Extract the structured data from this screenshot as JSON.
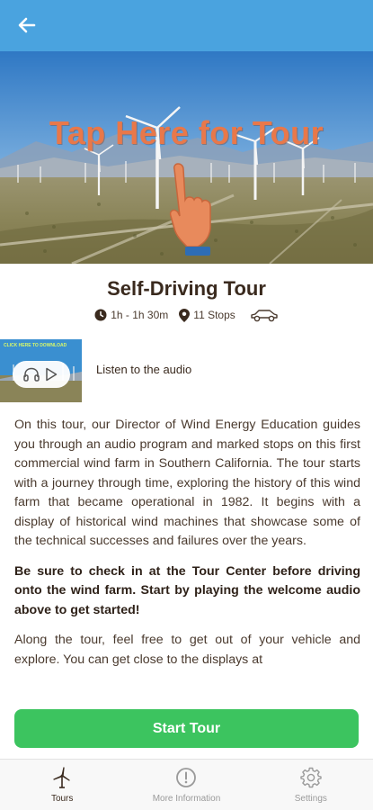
{
  "header": {
    "back_icon": "arrow-left-icon"
  },
  "hero": {
    "overlay_text": "Tap Here for Tour",
    "pointer_icon": "hand-pointer-icon"
  },
  "tour": {
    "title": "Self-Driving Tour",
    "duration": "1h - 1h 30m",
    "stops": "11 Stops",
    "duration_icon": "clock-icon",
    "stops_icon": "map-pin-icon",
    "vehicle_icon": "car-icon"
  },
  "audio": {
    "thumb_caption": "CLICK HERE TO DOWNLOAD",
    "label": "Listen to the audio",
    "headphones_icon": "headphones-icon",
    "play_icon": "play-icon"
  },
  "description": {
    "p1": "On this tour, our Director of Wind Energy Education guides you through an audio program and marked stops on this first commercial wind farm in Southern California. The tour starts with a journey through time, exploring the history of this wind farm that became operational in 1982. It begins with a display of historical wind machines that showcase some of the technical successes and failures over the years.",
    "p2": "Be sure to check in at the Tour Center before driving onto the wind farm. Start by playing the welcome audio above to get started!",
    "p3": "Along the tour, feel free to get out of your vehicle and explore. You can get close to the displays at"
  },
  "actions": {
    "start_label": "Start Tour"
  },
  "nav": {
    "items": [
      {
        "label": "Tours",
        "icon": "wind-turbine-icon",
        "active": true
      },
      {
        "label": "More Information",
        "icon": "info-circle-icon",
        "active": false
      },
      {
        "label": "Settings",
        "icon": "gear-icon",
        "active": false
      }
    ]
  },
  "colors": {
    "header": "#4aa3df",
    "accent_text": "#e8784a",
    "button": "#3cc45f"
  }
}
